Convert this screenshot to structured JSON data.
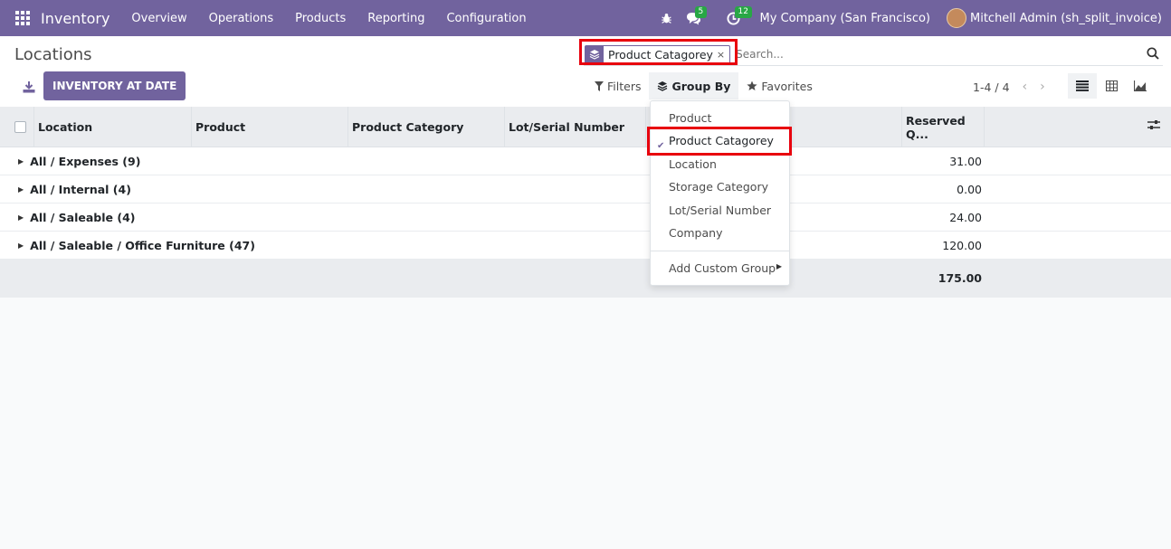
{
  "navbar": {
    "app_name": "Inventory",
    "menu": [
      "Overview",
      "Operations",
      "Products",
      "Reporting",
      "Configuration"
    ],
    "messages_count": "5",
    "activities_count": "12",
    "company": "My Company (San Francisco)",
    "user": "Mitchell Admin (sh_split_invoice)"
  },
  "control_panel": {
    "title": "Locations",
    "primary_button": "INVENTORY AT DATE",
    "search": {
      "facet_label": "Product Catagorey",
      "facet_close": "×",
      "placeholder": "Search..."
    },
    "filters_label": "Filters",
    "groupby_label": "Group By",
    "favorites_label": "Favorites",
    "pager": "1-4 / 4"
  },
  "table": {
    "headers": [
      "Location",
      "Product",
      "Product Category",
      "Lot/Serial Number",
      "Reserved Q..."
    ],
    "groups": [
      {
        "label": "All / Expenses (9)",
        "reserved": "31.00"
      },
      {
        "label": "All / Internal (4)",
        "reserved": "0.00"
      },
      {
        "label": "All / Saleable (4)",
        "reserved": "24.00"
      },
      {
        "label": "All / Saleable / Office Furniture (47)",
        "reserved": "120.00"
      }
    ],
    "total": "175.00"
  },
  "groupby_dropdown": {
    "items": [
      "Product",
      "Product Catagorey",
      "Location",
      "Storage Category",
      "Lot/Serial Number",
      "Company"
    ],
    "selected": "Product Catagorey",
    "custom": "Add Custom Group"
  },
  "colors": {
    "brand": "#71639e",
    "highlight": "#e8000d",
    "badge": "#28a745"
  }
}
